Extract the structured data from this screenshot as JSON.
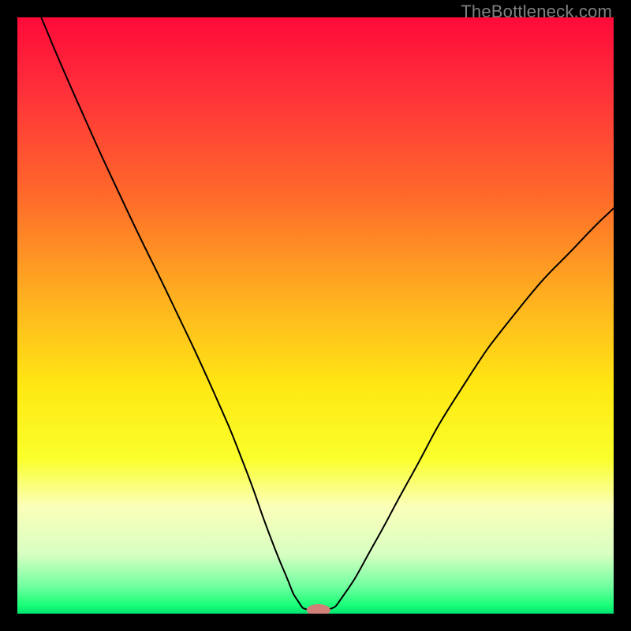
{
  "watermark": "TheBottleneck.com",
  "chart_data": {
    "type": "line",
    "title": "",
    "xlabel": "",
    "ylabel": "",
    "xlim": [
      0,
      100
    ],
    "ylim": [
      0,
      100
    ],
    "background_gradient": {
      "stops": [
        {
          "offset": 0.0,
          "color": "#ff0a3a"
        },
        {
          "offset": 0.12,
          "color": "#ff2f3a"
        },
        {
          "offset": 0.3,
          "color": "#ff6a2a"
        },
        {
          "offset": 0.48,
          "color": "#ffb41f"
        },
        {
          "offset": 0.62,
          "color": "#ffe813"
        },
        {
          "offset": 0.74,
          "color": "#faff2b"
        },
        {
          "offset": 0.82,
          "color": "#fbffb9"
        },
        {
          "offset": 0.9,
          "color": "#d8ffc2"
        },
        {
          "offset": 0.955,
          "color": "#6fffa0"
        },
        {
          "offset": 0.985,
          "color": "#1bff78"
        },
        {
          "offset": 1.0,
          "color": "#00e472"
        }
      ]
    },
    "series": [
      {
        "name": "bottleneck-curve",
        "color": "#000000",
        "points": [
          {
            "x": 4.0,
            "y": 100.0
          },
          {
            "x": 10.0,
            "y": 86.0
          },
          {
            "x": 18.0,
            "y": 68.5
          },
          {
            "x": 26.0,
            "y": 52.0
          },
          {
            "x": 33.0,
            "y": 37.0
          },
          {
            "x": 38.0,
            "y": 25.0
          },
          {
            "x": 42.0,
            "y": 14.0
          },
          {
            "x": 45.0,
            "y": 6.5
          },
          {
            "x": 47.0,
            "y": 2.2
          },
          {
            "x": 49.0,
            "y": 0.6
          },
          {
            "x": 52.0,
            "y": 0.6
          },
          {
            "x": 55.0,
            "y": 3.5
          },
          {
            "x": 60.0,
            "y": 12.0
          },
          {
            "x": 66.0,
            "y": 23.0
          },
          {
            "x": 74.0,
            "y": 37.0
          },
          {
            "x": 84.0,
            "y": 51.0
          },
          {
            "x": 94.0,
            "y": 62.0
          },
          {
            "x": 100.0,
            "y": 68.0
          }
        ]
      }
    ],
    "marker": {
      "name": "optimal-point",
      "x": 50.5,
      "y": 0.6,
      "color": "#d08078",
      "rx": 2.0,
      "ry": 1.0
    }
  }
}
